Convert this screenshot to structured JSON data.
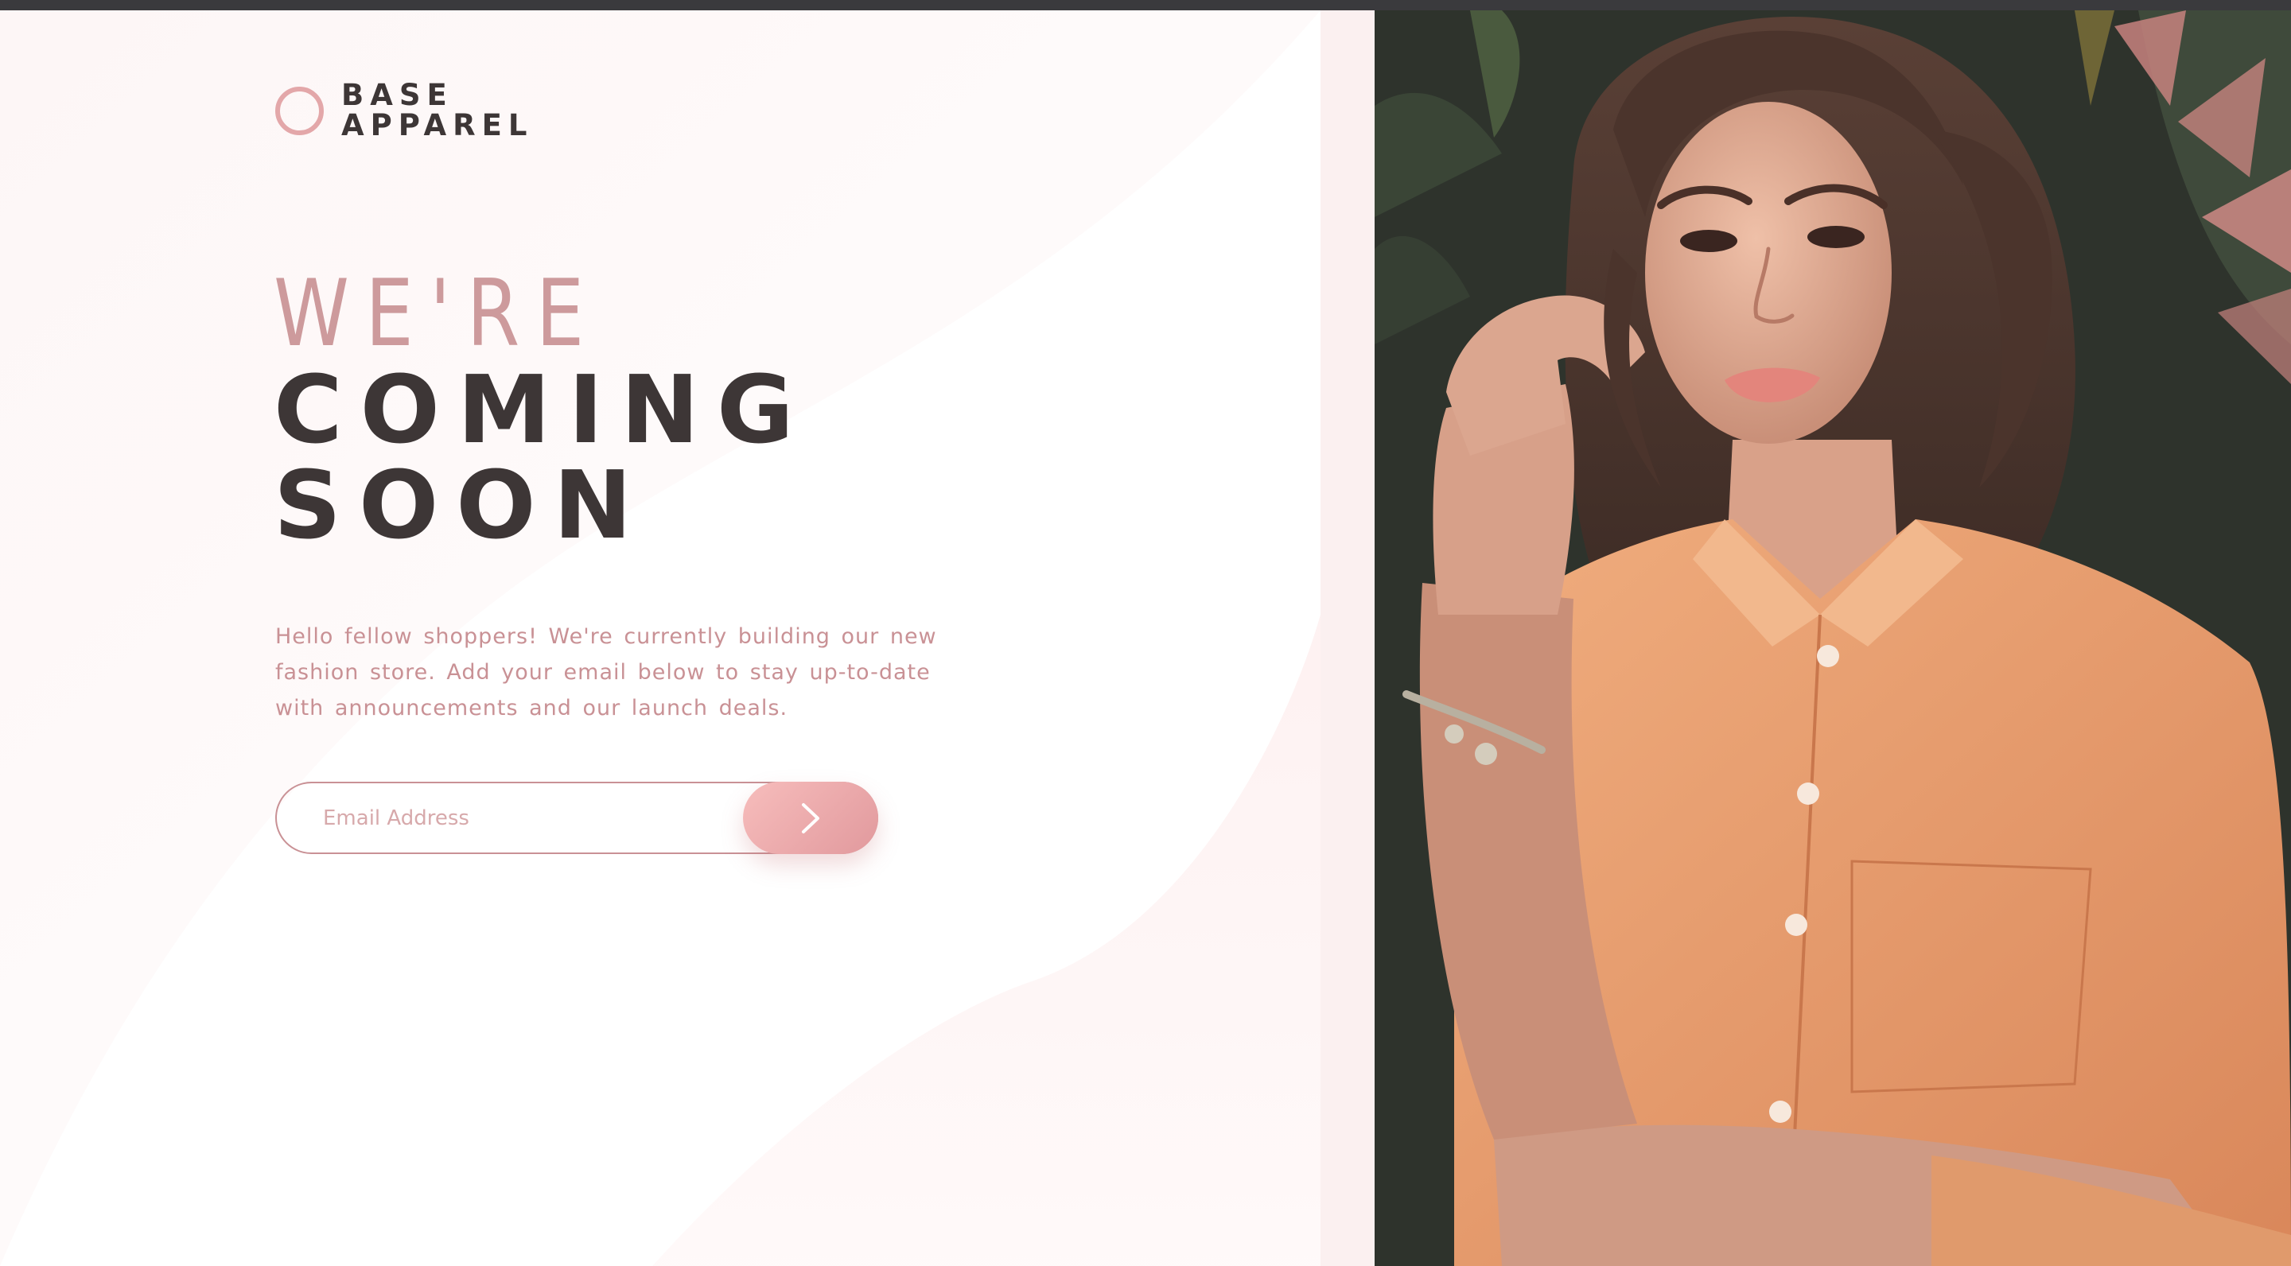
{
  "brand": {
    "line1": "BASE",
    "line2": "APPAREL"
  },
  "headline": {
    "light": "WE'RE",
    "dark1": "COMING",
    "dark2": "SOON"
  },
  "intro": "Hello fellow shoppers! We're currently building our new fashion store. Add your email below to stay up-to-date with announcements and our launch deals.",
  "form": {
    "email_placeholder": "Email Address",
    "email_value": "",
    "submit_icon": "arrow-right-icon"
  },
  "hero": {
    "subject": "woman-in-orange-shirt-photo"
  },
  "colors": {
    "accent_pink": "#e3a7a9",
    "text_dark": "#3d3636",
    "text_pink": "#c99195",
    "button_gradient_start": "#f7bdbc",
    "button_gradient_end": "#e1999d",
    "shirt_orange": "#e59b6c"
  }
}
